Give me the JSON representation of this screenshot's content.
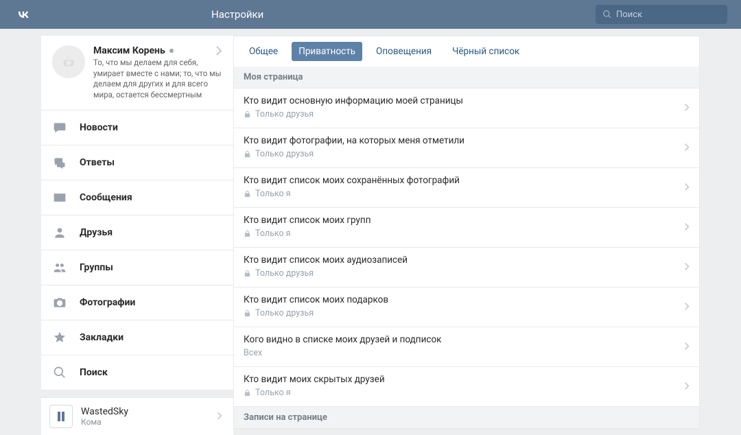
{
  "header": {
    "title": "Настройки",
    "search_placeholder": "Поиск"
  },
  "profile": {
    "name": "Максим Корень",
    "status": "То, что мы делаем для себя, умирает вместе с нами; то, что мы делаем для других и для всего мира, остается бессмертным"
  },
  "nav": [
    "Новости",
    "Ответы",
    "Сообщения",
    "Друзья",
    "Группы",
    "Фотографии",
    "Закладки",
    "Поиск"
  ],
  "player": {
    "title": "WastedSky",
    "subtitle": "Кома"
  },
  "tabs": {
    "general": "Общее",
    "privacy": "Приватность",
    "notifications": "Оповещения",
    "blacklist": "Чёрный список"
  },
  "sections": {
    "my_page": "Моя страница",
    "posts": "Записи на странице"
  },
  "settings": [
    {
      "title": "Кто видит основную информацию моей страницы",
      "value": "Только друзья",
      "lock": true
    },
    {
      "title": "Кто видит фотографии, на которых меня отметили",
      "value": "Только друзья",
      "lock": true
    },
    {
      "title": "Кто видит список моих сохранённых фотографий",
      "value": "Только я",
      "lock": true
    },
    {
      "title": "Кто видит список моих групп",
      "value": "Только я",
      "lock": true
    },
    {
      "title": "Кто видит список моих аудиозаписей",
      "value": "Только друзья",
      "lock": true
    },
    {
      "title": "Кто видит список моих подарков",
      "value": "Только друзья",
      "lock": true
    },
    {
      "title": "Кого видно в списке моих друзей и подписок",
      "value": "Всех",
      "lock": false
    },
    {
      "title": "Кто видит моих скрытых друзей",
      "value": "Только я",
      "lock": true
    }
  ]
}
